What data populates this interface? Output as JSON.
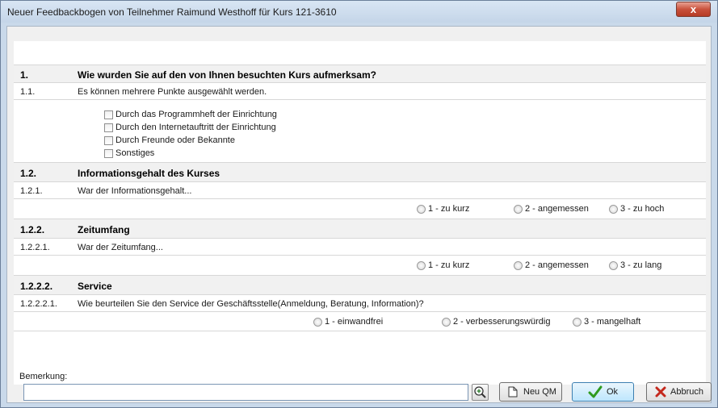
{
  "window": {
    "title": "Neuer Feedbackbogen von Teilnehmer Raimund Westhoff für Kurs 121-3610",
    "close_label": "x"
  },
  "sections": [
    {
      "num": "1.",
      "title": "Wie wurden Sie auf den von Ihnen besuchten Kurs aufmerksam?"
    },
    {
      "num": "1.1.",
      "text": "Es können mehrere Punkte ausgewählt werden."
    },
    {
      "checkboxes": [
        "Durch das Programmheft der Einrichtung",
        "Durch den Internetauftritt der Einrichtung",
        "Durch Freunde oder Bekannte",
        "Sonstiges"
      ]
    },
    {
      "num": "1.2.",
      "title": "Informationsgehalt des Kurses"
    },
    {
      "num": "1.2.1.",
      "text": "War der Informationsgehalt..."
    },
    {
      "options": [
        "1 - zu kurz",
        "2 - angemessen",
        "3 - zu hoch"
      ]
    },
    {
      "num": "1.2.2.",
      "title": "Zeitumfang"
    },
    {
      "num": "1.2.2.1.",
      "text": "War der Zeitumfang..."
    },
    {
      "options": [
        "1 - zu kurz",
        "2 - angemessen",
        "3 - zu lang"
      ]
    },
    {
      "num": "1.2.2.2.",
      "title": "Service"
    },
    {
      "num": "1.2.2.2.1.",
      "text": "Wie beurteilen Sie den Service der Geschäftsstelle(Anmeldung, Beratung, Information)?"
    },
    {
      "options": [
        "1 - einwandfrei",
        "2 - verbesserungswürdig",
        "3 - mangelhaft"
      ]
    }
  ],
  "footer": {
    "remark_label": "Bemerkung:",
    "remark_value": "",
    "new_qm_label": "Neu QM",
    "ok_label": "Ok",
    "cancel_label": "Abbruch"
  }
}
